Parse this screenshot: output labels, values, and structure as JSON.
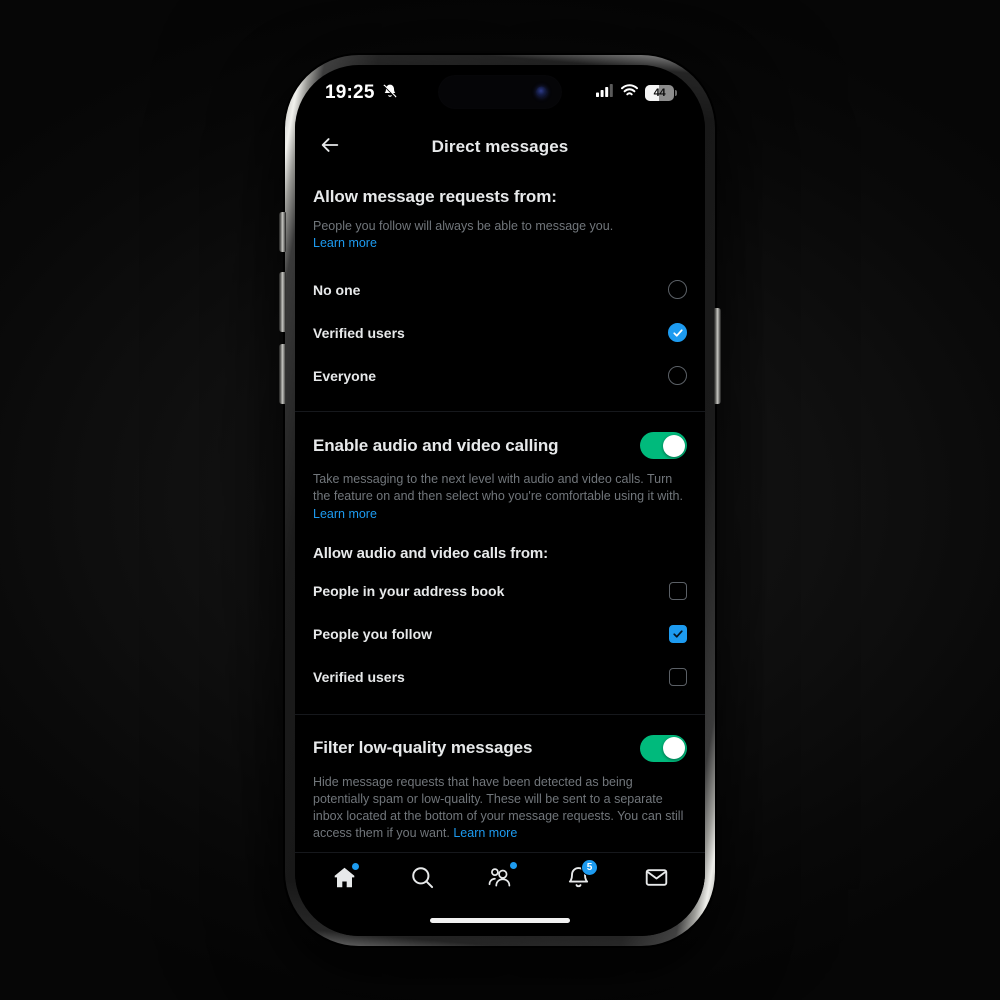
{
  "status_bar": {
    "time": "19:25",
    "silent_icon": "bell-slash-icon",
    "cellular_icon": "cellular-signal-icon",
    "wifi_icon": "wifi-icon",
    "battery_percent": "44",
    "battery_level": 44
  },
  "header": {
    "back_icon": "arrow-left-icon",
    "title": "Direct messages"
  },
  "sections": {
    "message_requests": {
      "title": "Allow message requests from:",
      "description": "People you follow will always be able to message you.",
      "learn_more": "Learn more",
      "options": [
        {
          "label": "No one",
          "selected": false
        },
        {
          "label": "Verified users",
          "selected": true
        },
        {
          "label": "Everyone",
          "selected": false
        }
      ]
    },
    "calling": {
      "title": "Enable audio and video calling",
      "toggle_on": true,
      "description": "Take messaging to the next level with audio and video calls. Turn the feature on and then select who you're comfortable using it with.",
      "learn_more": "Learn more",
      "subtitle": "Allow audio and video calls from:",
      "options": [
        {
          "label": "People in your address book",
          "checked": false
        },
        {
          "label": "People you follow",
          "checked": true
        },
        {
          "label": "Verified users",
          "checked": false
        }
      ]
    },
    "filter": {
      "title": "Filter low-quality messages",
      "toggle_on": true,
      "description": "Hide message requests that have been detected as being potentially spam or low-quality. These will be sent to a separate inbox located at the bottom of your message requests. You can still access them if you want.",
      "learn_more": "Learn more"
    }
  },
  "bottom_nav": {
    "items": [
      {
        "name": "home",
        "icon": "home-icon",
        "badge_dot": true,
        "badge_count": ""
      },
      {
        "name": "search",
        "icon": "search-icon",
        "badge_dot": false,
        "badge_count": ""
      },
      {
        "name": "communities",
        "icon": "communities-icon",
        "badge_dot": true,
        "badge_count": ""
      },
      {
        "name": "notifications",
        "icon": "bell-icon",
        "badge_dot": false,
        "badge_count": "5"
      },
      {
        "name": "messages",
        "icon": "envelope-icon",
        "badge_dot": false,
        "badge_count": ""
      }
    ]
  },
  "colors": {
    "accent_blue": "#1d9bf0",
    "toggle_green": "#00ba7c",
    "text_primary": "#e7e9ea",
    "text_secondary": "#71767b",
    "background": "#000000"
  }
}
